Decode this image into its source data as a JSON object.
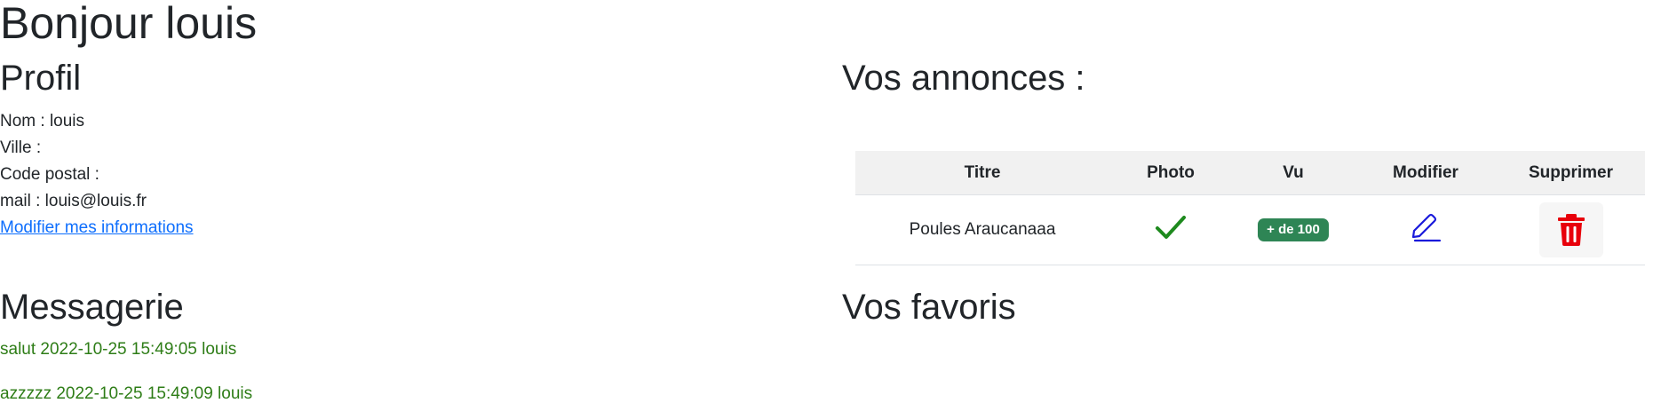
{
  "greeting": "Bonjour louis",
  "profile": {
    "heading": "Profil",
    "name_line": "Nom : louis",
    "city_line": "Ville :",
    "postal_line": "Code postal :",
    "mail_line": "mail : louis@louis.fr",
    "edit_link": "Modifier mes informations"
  },
  "messagerie": {
    "heading": "Messagerie",
    "messages": [
      "salut 2022-10-25 15:49:05 louis",
      "azzzzz 2022-10-25 15:49:09 louis"
    ]
  },
  "annonces": {
    "heading": "Vos annonces :",
    "columns": [
      "Titre",
      "Photo",
      "Vu",
      "Modifier",
      "Supprimer"
    ],
    "rows": [
      {
        "titre": "Poules Araucanaaa",
        "photo_icon": "check-icon",
        "vu": "+ de 100",
        "modifier_icon": "pencil-icon",
        "supprimer_icon": "trash-icon"
      }
    ]
  },
  "favoris": {
    "heading": "Vos favoris"
  },
  "colors": {
    "text": "#212529",
    "link": "#0d6efd",
    "message": "#2e7d17",
    "badge": "#2e8555",
    "check": "#1e8a1e",
    "pencil": "#1a1adb",
    "trash": "#e8000b",
    "table_header_bg": "#f1f1f1"
  }
}
